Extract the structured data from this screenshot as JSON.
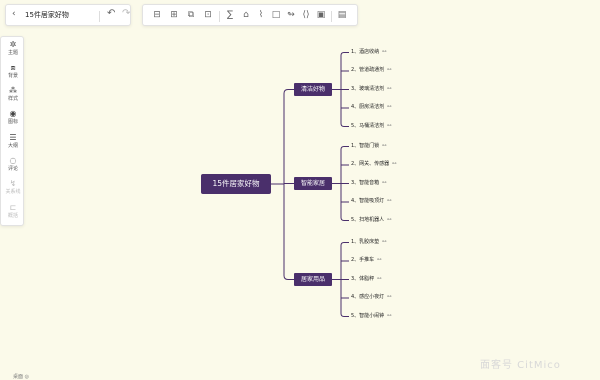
{
  "app": {
    "doc_title": "15件居家好物",
    "back_icon": "chevron-left-icon",
    "undo_icon": "undo-icon",
    "redo_icon": "redo-icon"
  },
  "toolbar": {
    "icons": [
      "insert-sibling-icon",
      "insert-child-icon",
      "insert-parent-icon",
      "delete-node-icon",
      "formula-icon",
      "tag-icon",
      "attachment-icon",
      "shape-icon",
      "relation-icon",
      "summary-icon",
      "outline-frame-icon",
      "calendar-icon",
      "image-icon",
      "note-icon"
    ]
  },
  "sidebar": {
    "items": [
      {
        "label": "主题",
        "icon": "theme-icon",
        "enabled": true
      },
      {
        "label": "背景",
        "icon": "background-icon",
        "enabled": true
      },
      {
        "label": "样式",
        "icon": "style-icon",
        "enabled": true
      },
      {
        "label": "图标",
        "icon": "icon-library-icon",
        "enabled": true
      },
      {
        "label": "大纲",
        "icon": "outline-icon",
        "enabled": true
      },
      {
        "label": "评论",
        "icon": "comment-icon",
        "enabled": true
      },
      {
        "label": "关系线",
        "icon": "relation-line-icon",
        "enabled": false
      },
      {
        "label": "概括",
        "icon": "summary-icon",
        "enabled": false
      }
    ]
  },
  "mindmap": {
    "root": "15件居家好物",
    "branches": [
      {
        "label": "清洁好物",
        "children": [
          "1、酒店收纳",
          "2、管道疏通剂",
          "3、玻璃清洁剂",
          "4、厨房清洁剂",
          "5、马桶清洁剂"
        ]
      },
      {
        "label": "智能家居",
        "children": [
          "1、智能门锁",
          "2、网关、传感器",
          "3、智能音箱",
          "4、智能吸顶灯",
          "5、扫地机器人"
        ]
      },
      {
        "label": "居家用品",
        "children": [
          "1、乳胶床垫",
          "2、手推车",
          "3、体脂秤",
          "4、感应小夜灯",
          "5、智能小闹钟"
        ]
      }
    ],
    "link_symbol": "⚯"
  },
  "colors": {
    "background": "#fbfaea",
    "node_fill": "#4a2f6b",
    "connector": "#4a2f6b"
  },
  "watermark": "面客号 CitMico",
  "footer": "桌面 ◎"
}
